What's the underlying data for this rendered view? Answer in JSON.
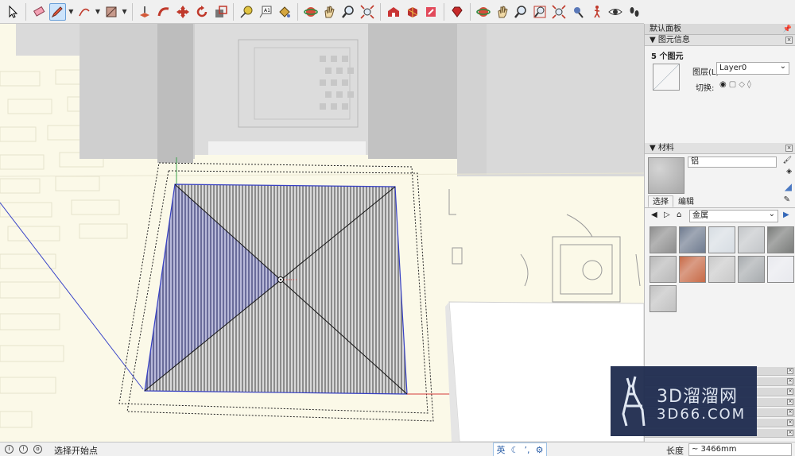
{
  "toolbar": {
    "tools": [
      {
        "name": "select-tool",
        "icon": "arrow-cursor-icon"
      },
      {
        "name": "eraser-tool",
        "icon": "eraser-icon"
      },
      {
        "name": "pencil-tool",
        "icon": "pencil-icon",
        "active": true
      },
      {
        "name": "arc-tool",
        "icon": "arc-icon"
      },
      {
        "name": "rectangle-tool",
        "icon": "rectangle-icon"
      },
      {
        "name": "push-pull-tool",
        "icon": "push-pull-icon"
      },
      {
        "name": "follow-me-tool",
        "icon": "follow-me-icon"
      },
      {
        "name": "move-tool",
        "icon": "move-icon"
      },
      {
        "name": "rotate-tool",
        "icon": "rotate-icon"
      },
      {
        "name": "scale-tool",
        "icon": "scale-icon"
      },
      {
        "name": "tape-measure-tool",
        "icon": "tape-measure-icon"
      },
      {
        "name": "text-tool",
        "icon": "text-icon"
      },
      {
        "name": "paint-bucket-tool",
        "icon": "paint-bucket-icon"
      },
      {
        "name": "orbit-tool",
        "icon": "orbit-icon"
      },
      {
        "name": "pan-tool",
        "icon": "hand-icon"
      },
      {
        "name": "zoom-tool",
        "icon": "zoom-icon"
      },
      {
        "name": "zoom-extents-tool",
        "icon": "zoom-extents-icon"
      },
      {
        "name": "warehouse-tool",
        "icon": "warehouse-icon"
      },
      {
        "name": "components-tool",
        "icon": "components-icon"
      },
      {
        "name": "share-tool",
        "icon": "share-icon"
      },
      {
        "name": "ruby-tool",
        "icon": "ruby-icon"
      },
      {
        "name": "orbit-tool-2",
        "icon": "orbit-icon"
      },
      {
        "name": "pan-tool-2",
        "icon": "hand-icon"
      },
      {
        "name": "zoom-tool-2",
        "icon": "zoom-icon"
      },
      {
        "name": "zoom-window-tool",
        "icon": "zoom-window-icon"
      },
      {
        "name": "zoom-extents-tool-2",
        "icon": "zoom-extents-icon"
      },
      {
        "name": "position-camera-tool",
        "icon": "position-camera-icon"
      },
      {
        "name": "walk-tool",
        "icon": "walk-icon"
      },
      {
        "name": "look-around-tool",
        "icon": "eye-icon"
      },
      {
        "name": "footprints-tool",
        "icon": "footprints-icon"
      }
    ]
  },
  "panel": {
    "title": "默认面板",
    "entity_info": {
      "title": "图元信息",
      "count": "5 个图元",
      "layer_label": "图层(L):",
      "layer_value": "Layer0",
      "toggle_label": "切换:"
    },
    "materials": {
      "title": "材料",
      "name": "铝",
      "tab_select": "选择",
      "tab_edit": "编辑",
      "library": "金属",
      "swatch_colors": [
        "#8e8e8e",
        "#6f7b8f",
        "#d7dde3",
        "#c3c6c9",
        "#7a7c7a",
        "#b8b8b8",
        "#c76a47",
        "#c9c9c9",
        "#a7abae",
        "#e8e9ee",
        "#c1c1c1"
      ]
    }
  },
  "status": {
    "message": "选择开始点",
    "ime_lang": "英",
    "length_label": "长度",
    "length_value": "~ 3466mm"
  },
  "watermark": {
    "brand": "3D溜溜网",
    "url": "3D66.COM"
  }
}
